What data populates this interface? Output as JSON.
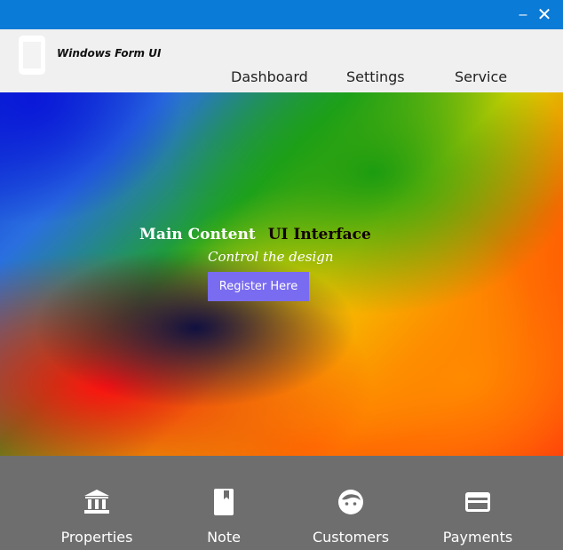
{
  "titlebar": {
    "minimize_label": "–",
    "close_label": "✕",
    "color": "#0a7bd6"
  },
  "header": {
    "app_icon": "phone-icon",
    "brand": "Windows Form UI",
    "nav": {
      "dashboard": "Dashboard",
      "settings": "Settings",
      "service": "Service"
    }
  },
  "hero": {
    "title_part1": "Main Content",
    "title_part2": "UI Interface",
    "subtitle": "Control the design",
    "button_label": "Register Here",
    "button_color": "#7a6cf0"
  },
  "footer": {
    "background": "#6e6e6e",
    "items": [
      {
        "label": "Properties",
        "icon": "bank-icon"
      },
      {
        "label": "Note",
        "icon": "book-icon"
      },
      {
        "label": "Customers",
        "icon": "face-icon"
      },
      {
        "label": "Payments",
        "icon": "credit-card-icon"
      }
    ]
  }
}
